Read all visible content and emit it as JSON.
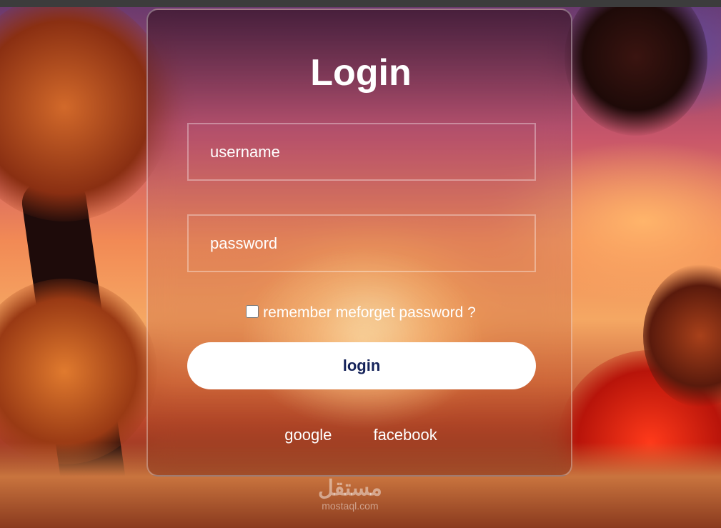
{
  "form": {
    "title": "Login",
    "username_placeholder": "username",
    "password_placeholder": "password",
    "remember_label": "remember me",
    "forgot_label": "forget password ?",
    "login_button": "login"
  },
  "social": {
    "google": "google",
    "facebook": "facebook"
  },
  "watermark": {
    "logo_text": "مستقل",
    "domain": "mostaql.com"
  },
  "colors": {
    "button_bg": "#ffffff",
    "button_text": "#15235a",
    "text": "#ffffff"
  }
}
